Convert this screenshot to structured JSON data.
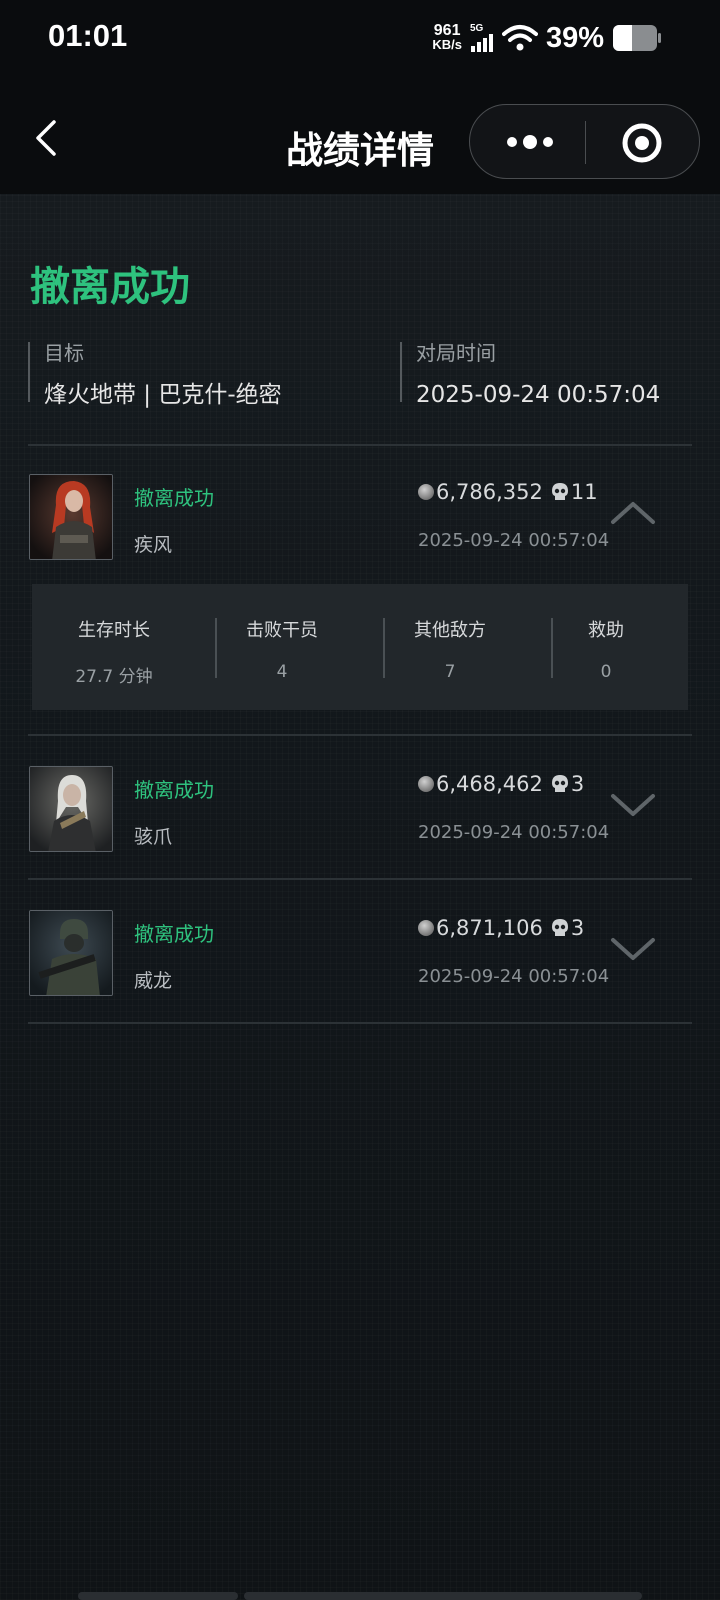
{
  "status_bar": {
    "time": "01:01",
    "net_speed_value": "961",
    "net_speed_unit": "KB/s",
    "network_type": "5G",
    "battery_percent": "39%"
  },
  "nav": {
    "title": "战绩详情"
  },
  "summary": {
    "result": "撤离成功",
    "target_label": "目标",
    "target_value": "烽火地带 | 巴克什-绝密",
    "time_label": "对局时间",
    "time_value": "2025-09-24 00:57:04"
  },
  "players": [
    {
      "status": "撤离成功",
      "name": "疾风",
      "money": "6,786,352",
      "kills": "11",
      "time": "2025-09-24 00:57:04",
      "expanded": true
    },
    {
      "status": "撤离成功",
      "name": "骇爪",
      "money": "6,468,462",
      "kills": "3",
      "time": "2025-09-24 00:57:04",
      "expanded": false
    },
    {
      "status": "撤离成功",
      "name": "威龙",
      "money": "6,871,106",
      "kills": "3",
      "time": "2025-09-24 00:57:04",
      "expanded": false
    }
  ],
  "stats": [
    {
      "label": "生存时长",
      "value": "27.7 分钟"
    },
    {
      "label": "击败干员",
      "value": "4"
    },
    {
      "label": "其他敌方",
      "value": "7"
    },
    {
      "label": "救助",
      "value": "0"
    }
  ],
  "colors": {
    "accent_green": "#2ec27e",
    "background": "#101418",
    "panel": "#22272b"
  }
}
